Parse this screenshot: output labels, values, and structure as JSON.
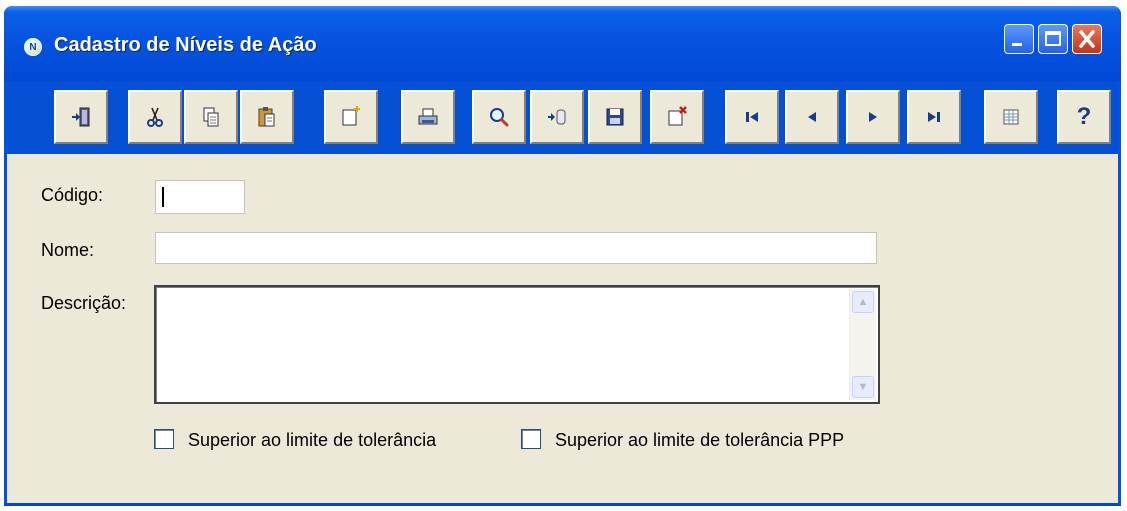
{
  "window": {
    "title": "Cadastro de Níveis de Ação",
    "app_icon_letter": "N",
    "controls": [
      "minimize-icon",
      "maximize-icon",
      "close-icon"
    ]
  },
  "toolbar": {
    "buttons": [
      {
        "name": "exit-button",
        "icon": "exit-door-icon"
      },
      {
        "name": "cut-button",
        "icon": "scissors-icon"
      },
      {
        "name": "copy-button",
        "icon": "copy-icon"
      },
      {
        "name": "paste-button",
        "icon": "paste-icon"
      },
      {
        "name": "new-button",
        "icon": "new-document-icon"
      },
      {
        "name": "print-button",
        "icon": "printer-icon"
      },
      {
        "name": "search-button",
        "icon": "magnifier-icon"
      },
      {
        "name": "insert-record-button",
        "icon": "database-insert-icon"
      },
      {
        "name": "save-button",
        "icon": "floppy-disk-icon"
      },
      {
        "name": "delete-button",
        "icon": "delete-document-icon"
      },
      {
        "name": "first-record-button",
        "icon": "first-icon"
      },
      {
        "name": "previous-record-button",
        "icon": "previous-icon"
      },
      {
        "name": "next-record-button",
        "icon": "next-icon"
      },
      {
        "name": "last-record-button",
        "icon": "last-icon"
      },
      {
        "name": "grid-view-button",
        "icon": "table-icon"
      },
      {
        "name": "help-button",
        "icon": "help-icon",
        "label": "?"
      }
    ]
  },
  "form": {
    "codigo": {
      "label": "Código:",
      "value": ""
    },
    "nome": {
      "label": "Nome:",
      "value": ""
    },
    "descricao": {
      "label": "Descrição:",
      "value": ""
    },
    "checkboxes": [
      {
        "label": "Superior ao limite de tolerância",
        "checked": false
      },
      {
        "label": "Superior ao limite de tolerância PPP",
        "checked": false
      }
    ]
  },
  "colors": {
    "titlebar": "#0054e3",
    "client_background": "#ece9d8",
    "close_button": "#c2351b"
  }
}
